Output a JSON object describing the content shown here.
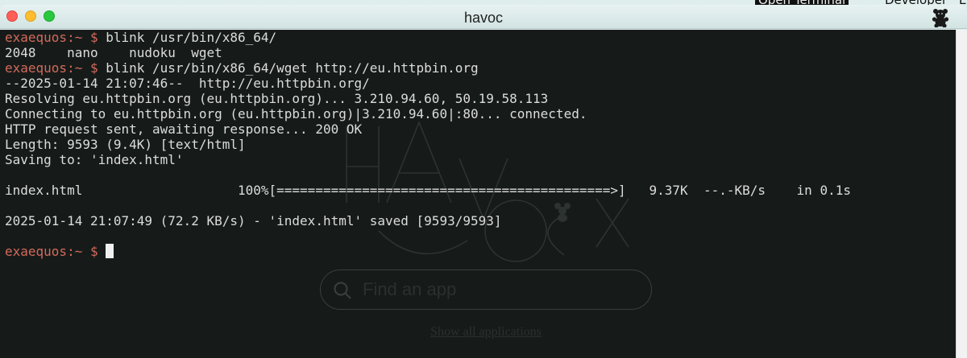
{
  "desktop": {
    "topbar": {
      "open_terminal": "Open Terminal",
      "developer": "Developer",
      "more": "E"
    }
  },
  "window": {
    "title": "havoc",
    "icon": "teddy-bear-icon"
  },
  "terminal": {
    "prompt": "exaequos:~ $",
    "lines": [
      {
        "prompt": "exaequos:~ $",
        "text": " blink /usr/bin/x86_64/"
      },
      {
        "text": "2048    nano    nudoku  wget"
      },
      {
        "prompt": "exaequos:~ $",
        "text": " blink /usr/bin/x86_64/wget http://eu.httpbin.org"
      },
      {
        "text": "--2025-01-14 21:07:46--  http://eu.httpbin.org/"
      },
      {
        "text": "Resolving eu.httpbin.org (eu.httpbin.org)... 3.210.94.60, 50.19.58.113"
      },
      {
        "text": "Connecting to eu.httpbin.org (eu.httpbin.org)|3.210.94.60|:80... connected."
      },
      {
        "text": "HTTP request sent, awaiting response... 200 OK"
      },
      {
        "text": "Length: 9593 (9.4K) [text/html]"
      },
      {
        "text": "Saving to: 'index.html'"
      },
      {
        "text": ""
      },
      {
        "text": "index.html                    100%[===========================================>]   9.37K  --.-KB/s    in 0.1s"
      },
      {
        "text": ""
      },
      {
        "text": "2025-01-14 21:07:49 (72.2 KB/s) - 'index.html' saved [9593/9593]"
      },
      {
        "text": ""
      },
      {
        "prompt": "exaequos:~ $",
        "text": " ",
        "cursor": true
      }
    ],
    "colors": {
      "background": "#161b19",
      "foreground": "#dcdcdc",
      "prompt": "#d36a5c"
    }
  },
  "background_desktop": {
    "search_placeholder": "Find an app",
    "show_all_link": "Show all applications"
  }
}
